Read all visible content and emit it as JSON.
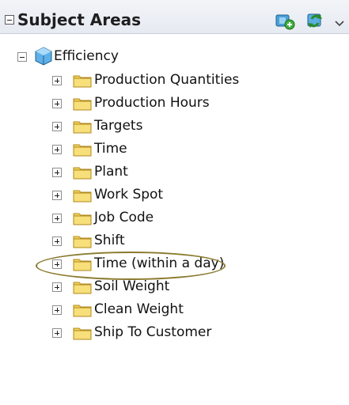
{
  "header": {
    "title": "Subject Areas",
    "collapse_icon": "minus-box-icon",
    "add_icon": "add-subject-area-icon",
    "refresh_icon": "refresh-icon",
    "menu_icon": "chevron-down-icon"
  },
  "tree": {
    "root": {
      "label": "Efficiency",
      "icon": "cube-icon",
      "expanded": true
    },
    "folders": [
      {
        "label": "Production Quantities"
      },
      {
        "label": "Production Hours"
      },
      {
        "label": "Targets"
      },
      {
        "label": "Time"
      },
      {
        "label": "Plant"
      },
      {
        "label": "Work Spot"
      },
      {
        "label": "Job Code"
      },
      {
        "label": "Shift"
      },
      {
        "label": "Time (within a day)"
      },
      {
        "label": "Soil Weight"
      },
      {
        "label": "Clean Weight"
      },
      {
        "label": "Ship To Customer"
      }
    ]
  },
  "colors": {
    "folder": "#f2d35a",
    "folder_outline": "#b08a1e",
    "highlight": "#8a7a2e"
  }
}
